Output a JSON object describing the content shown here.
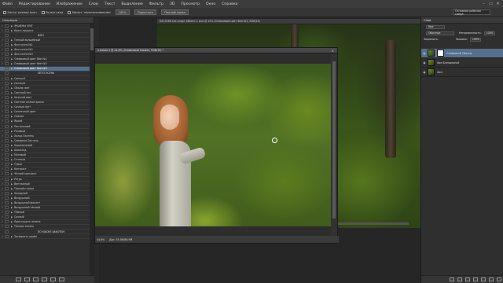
{
  "menubar": {
    "items": [
      "Файл",
      "Редактирование",
      "Изображение",
      "Слои",
      "Текст",
      "Выделение",
      "Фильтр",
      "3D",
      "Просмотр",
      "Окно",
      "Справка"
    ],
    "window_controls": [
      "–",
      "▭",
      "✕"
    ]
  },
  "options": {
    "items": [
      {
        "label": "Настр. размер окон",
        "check": true
      },
      {
        "label": "Во все окна",
        "check": true
      },
      {
        "label": "Масшт. перетаскиванием",
        "check": true
      }
    ],
    "zoom_button": "100%",
    "fit_button": "Подогнать",
    "fill_button": "Полный экран",
    "workspace": "Основная рабочая среда"
  },
  "actions_panel": {
    "tab": "Операции",
    "rows": [
      {
        "check": "✓",
        "label": "ЭКШЕНЫ VINT",
        "type": "set"
      },
      {
        "check": "✓",
        "label": "Кросс-процесс",
        "type": "action"
      },
      {
        "check": "",
        "label": "ФОН",
        "type": "sep"
      },
      {
        "check": "✓",
        "label": "Теплый волшебный",
        "type": "action"
      },
      {
        "check": "✓",
        "label": "Фон сочно №1",
        "type": "action"
      },
      {
        "check": "✓",
        "label": "Фон сочно №2",
        "type": "action"
      },
      {
        "check": "✓",
        "label": "Фон сочно №3",
        "type": "action"
      },
      {
        "check": "✓",
        "label": "Оливковый цвет Фон №1",
        "type": "action"
      },
      {
        "check": "✓",
        "label": "Оливковый цвет Фон №2",
        "type": "action"
      },
      {
        "check": "✓",
        "label": "Оливковый цвет Фон №3",
        "type": "selected"
      },
      {
        "check": "",
        "label": "ЛЕТО ОСЕНЬ",
        "type": "sep"
      },
      {
        "check": "✓",
        "label": "Солнце1",
        "type": "action"
      },
      {
        "check": "✓",
        "label": "Солнце2",
        "type": "action"
      },
      {
        "check": "✓",
        "label": "Объём свет",
        "type": "action"
      },
      {
        "check": "✓",
        "label": "Светлый тон",
        "type": "action"
      },
      {
        "check": "✓",
        "label": "Нежный свет",
        "type": "action"
      },
      {
        "check": "✓",
        "label": "Светлое сочное время",
        "type": "action"
      },
      {
        "check": "✓",
        "label": "Сочные свет",
        "type": "action"
      },
      {
        "check": "✓",
        "label": "Солнечный цвет",
        "type": "action"
      },
      {
        "check": "✓",
        "label": "Сияние",
        "type": "action"
      },
      {
        "check": "✓",
        "label": "Яркий",
        "type": "action"
      },
      {
        "check": "✓",
        "label": "Пастельный",
        "type": "action"
      },
      {
        "check": "✓",
        "label": "Розовый",
        "type": "action"
      },
      {
        "check": "✓",
        "label": "Холод Пастель",
        "type": "action"
      },
      {
        "check": "✓",
        "label": "Северная Пастель",
        "type": "action"
      },
      {
        "check": "✓",
        "label": "Карамельный",
        "type": "action"
      },
      {
        "check": "✓",
        "label": "Шоколад",
        "type": "action"
      },
      {
        "check": "✓",
        "label": "Матовый",
        "type": "action"
      },
      {
        "check": "✓",
        "label": "Оттенки",
        "type": "action"
      },
      {
        "check": "✓",
        "label": "Туман",
        "type": "action"
      },
      {
        "check": "✓",
        "label": "Контраст",
        "type": "action"
      },
      {
        "check": "✓",
        "label": "Чёткий контраст",
        "type": "action"
      },
      {
        "check": "✓",
        "label": "Ретро",
        "type": "action"
      },
      {
        "check": "✓",
        "label": "Винтажный",
        "type": "action"
      },
      {
        "check": "✓",
        "label": "Тёплый+тонки",
        "type": "action"
      },
      {
        "check": "✓",
        "label": "Холодный",
        "type": "action"
      },
      {
        "check": "✓",
        "label": "Воздушный",
        "type": "action"
      },
      {
        "check": "✓",
        "label": "Воздушный фиолет",
        "type": "action"
      },
      {
        "check": "✓",
        "label": "Воздушный тёплый",
        "type": "action"
      },
      {
        "check": "✓",
        "label": "Тёмный",
        "type": "action"
      },
      {
        "check": "✓",
        "label": "Сочный",
        "type": "action"
      },
      {
        "check": "✓",
        "label": "Приглушить зелень",
        "type": "action"
      },
      {
        "check": "✓",
        "label": "Тёплые зелень",
        "type": "action"
      },
      {
        "check": "",
        "label": "ПО МАСКЕ ЗАКОТЕМ",
        "type": "sep"
      },
      {
        "check": "✓",
        "label": "Затемнить крайн",
        "type": "action"
      }
    ]
  },
  "doc_back": {
    "tab": "DSC0286 как смарт-объект-1 или @ 10% (Оливковый цвет Фон №2, RGB/16)"
  },
  "doc_front": {
    "tab": "n-копия-1 @ 44,6% (Оливковый Свемен, RGB/16) *",
    "close": "×",
    "zoom": "44,6%",
    "info": "Док: 55,3М/89,9М"
  },
  "layers_panel": {
    "tab": "Слои",
    "kind_label": "Вид",
    "blend_mode": "Обычные",
    "opacity_label": "Непрозрачность:",
    "opacity": "100%",
    "lock_label": "Закрепить:",
    "fill_label": "Заливка:",
    "fill": "100%",
    "layers": [
      {
        "name": "Оливковый Сбалсы",
        "selected": true,
        "mask": true
      },
      {
        "name": "Фон Блендерной",
        "selected": false,
        "mask": false
      },
      {
        "name": "Фон",
        "selected": false,
        "mask": false
      }
    ]
  },
  "colors": {
    "selection": "#55708f",
    "panel": "#2f2f2f",
    "menubar": "#3c3c3c"
  }
}
